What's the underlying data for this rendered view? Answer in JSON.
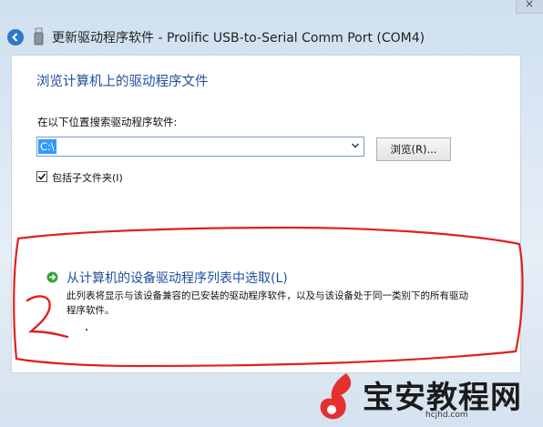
{
  "window": {
    "title": "更新驱动程序软件 - Prolific USB-to-Serial Comm Port (COM4)",
    "close_glyph": "×",
    "back_icon": "back-arrow-icon",
    "device_icon": "usb-device-icon"
  },
  "main": {
    "heading": "浏览计算机上的驱动程序文件",
    "search_label": "在以下位置搜索驱动程序软件:",
    "path_value": "C:\\",
    "browse_button": "浏览(R)...",
    "include_subfolders": {
      "label": "包括子文件夹(I)",
      "checked": true
    },
    "pick_option": {
      "icon": "green-arrow-icon",
      "title": "从计算机的设备驱动程序列表中选取(L)",
      "description": "此列表将显示与该设备兼容的已安装的驱动程序软件，以及与该设备处于同一类别下的所有驱动程序软件。"
    }
  },
  "annotation": {
    "color": "#e02020",
    "handwritten_label": "2"
  },
  "watermark": {
    "text": "宝安教程网",
    "url": "hcjhd.com",
    "logo_color": "#e53030"
  },
  "colors": {
    "link_blue": "#1f4e9e",
    "selection": "#3399ff"
  }
}
